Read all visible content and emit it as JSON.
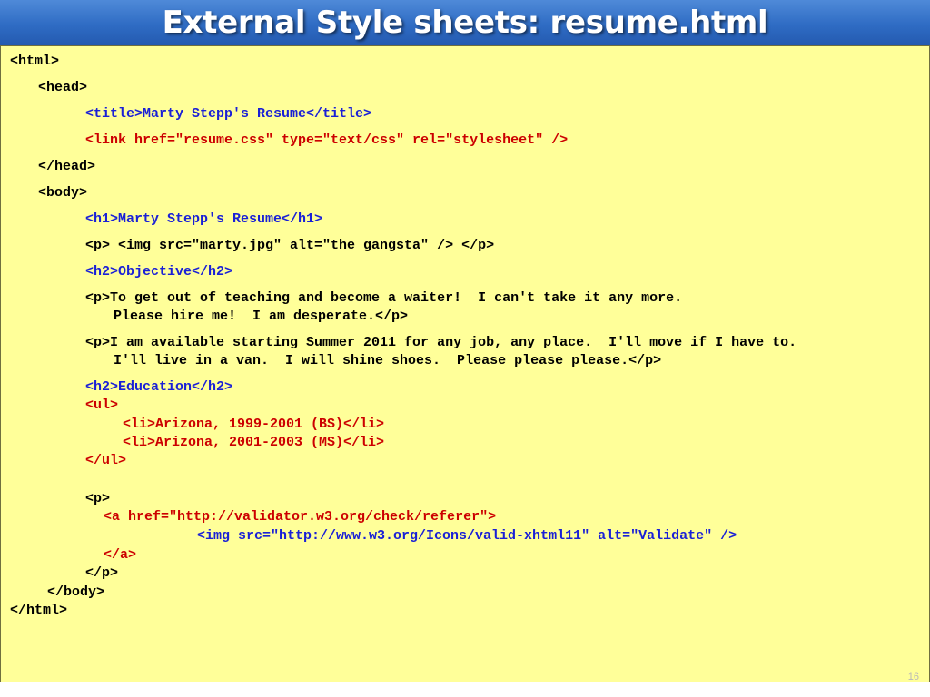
{
  "slide": {
    "title": "External Style sheets: resume.html",
    "page_number": "16"
  },
  "colors": {
    "title_bar": "#2f6cc4",
    "panel_background": "#ffff99",
    "code_black": "#000000",
    "code_blue": "#1a20d6",
    "code_red": "#cc0000"
  },
  "code": {
    "html_open": "<html>",
    "head_open": "<head>",
    "title_tag": "<title>Marty Stepp's Resume</title>",
    "link_tag": "<link href=\"resume.css\" type=\"text/css\" rel=\"stylesheet\" />",
    "head_close": "</head>",
    "body_open": "<body>",
    "h1_tag": "<h1>Marty Stepp's Resume</h1>",
    "img_paragraph": "<p> <img src=\"marty.jpg\" alt=\"the gangsta\" /> </p>",
    "h2_objective": "<h2>Objective</h2>",
    "p_objective_1": "<p>To get out of teaching and become a waiter!  I can't take it any more.",
    "p_objective_2": "Please hire me!  I am desperate.</p>",
    "p_available_1": "<p>I am available starting Summer 2011 for any job, any place.  I'll move if I have to.",
    "p_available_2": "I'll live in a van.  I will shine shoes.  Please please please.</p>",
    "h2_education": "<h2>Education</h2>",
    "ul_open": "<ul>",
    "li_1": "<li>Arizona, 1999-2001 (BS)</li>",
    "li_2": "<li>Arizona, 2001-2003 (MS)</li>",
    "ul_close": "</ul>",
    "p_open": "<p>",
    "a_open": "<a href=\"http://validator.w3.org/check/referer\">",
    "img_validate": "<img src=\"http://www.w3.org/Icons/valid-xhtml11\" alt=\"Validate\" />",
    "a_close": "</a>",
    "p_close": "</p>",
    "body_close": "</body>",
    "html_close": "</html>"
  }
}
